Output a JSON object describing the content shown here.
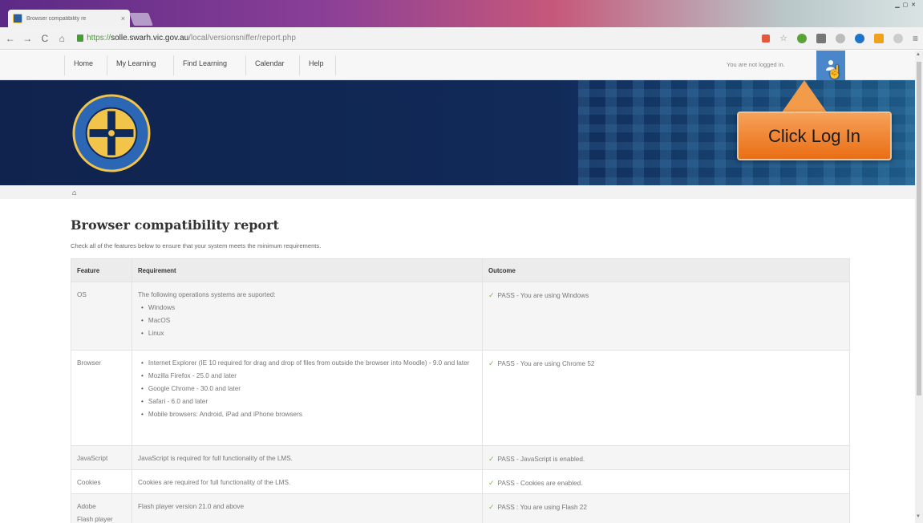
{
  "browser": {
    "tab_title": "Browser compatibility re",
    "tab_close": "×",
    "url_scheme": "https://",
    "url_host": "solle.swarh.vic.gov.au",
    "url_path": "/local/versionsniffer/report.php"
  },
  "navbar": {
    "items": [
      {
        "label": "Home"
      },
      {
        "label": "My Learning"
      },
      {
        "label": "Find Learning"
      },
      {
        "label": "Calendar"
      },
      {
        "label": "Help"
      }
    ],
    "login_status": "You are not logged in."
  },
  "callout": {
    "text": "Click Log In"
  },
  "page": {
    "title": "Browser compatibility report",
    "description": "Check all of the features below to ensure that your system meets the minimum requirements."
  },
  "table": {
    "headers": [
      "Feature",
      "Requirement",
      "Outcome"
    ],
    "rows": [
      {
        "feature": "OS",
        "requirement_intro": "The following operations systems are suported:",
        "requirement_list": [
          "Windows",
          "MacOS",
          "Linux"
        ],
        "outcome": "PASS - You are using Windows"
      },
      {
        "feature": "Browser",
        "requirement_list": [
          "Internet Explorer (IE 10 required for drag and drop of files from outside the browser into Moodle) - 9.0 and later",
          "Mozilla Firefox - 25.0 and later",
          "Google Chrome - 30.0 and later",
          "Safari - 6.0 and later",
          "Mobile browsers: Android, iPad and iPhone browsers"
        ],
        "outcome": "PASS - You are using Chrome 52"
      },
      {
        "feature": "JavaScript",
        "requirement": "JavaScript is required for full functionality of the LMS.",
        "outcome": "PASS - JavaScript is enabled."
      },
      {
        "feature": "Cookies",
        "requirement": "Cookies are required for full functionality of the LMS.",
        "outcome": "PASS - Cookies are enabled."
      },
      {
        "feature_line1": "Adobe",
        "feature_line2": "Flash player",
        "requirement": "Flash player version 21.0 and above",
        "outcome": "PASS : You are using Flash 22"
      }
    ]
  },
  "colors": {
    "banner": "#112a58",
    "callout": "#f08a35",
    "user_button": "#4a86c9",
    "pass_check": "#7fb542"
  }
}
